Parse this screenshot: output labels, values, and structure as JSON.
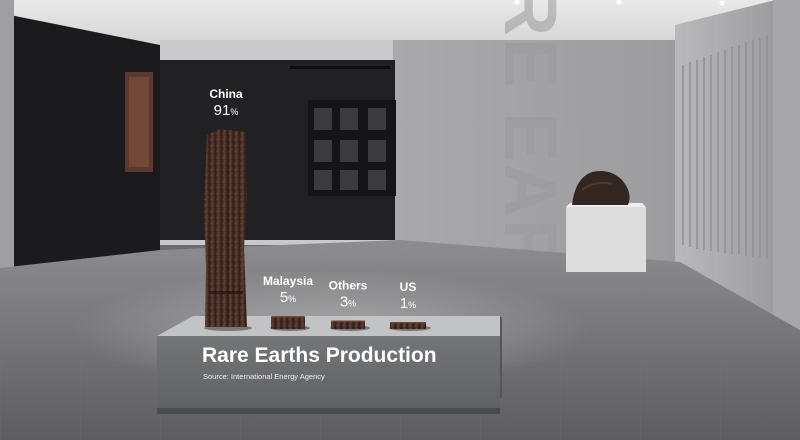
{
  "wall_text": "RARE EARTHS",
  "plinth": {
    "title": "Rare Earths Production",
    "source": "Source: International Energy Agency"
  },
  "chart_data": {
    "type": "bar",
    "title": "Rare Earths Production",
    "source": "Source: International Energy Agency",
    "categories": [
      "China",
      "Malaysia",
      "Others",
      "US"
    ],
    "values": [
      91,
      5,
      3,
      1
    ],
    "unit": "%",
    "ylim": [
      0,
      91
    ],
    "bar_style": "3D rock specimens on a display plinth"
  },
  "colors": {
    "rock_dark": "#2d1d18",
    "rock_mid": "#5a3b2e",
    "rock_light": "#7a5243",
    "label_text": "#ffffff",
    "plinth_front": "#6d6e70",
    "plinth_top": "#c2c3c5",
    "dark_wall": "#1b1b1d"
  }
}
